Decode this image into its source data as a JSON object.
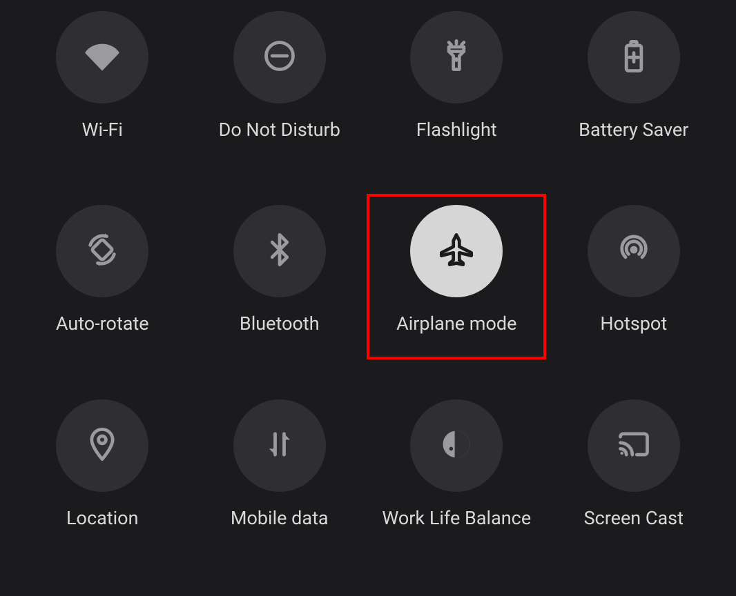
{
  "tiles": {
    "wifi": {
      "label": "Wi-Fi"
    },
    "dnd": {
      "label": "Do Not Disturb"
    },
    "flashlight": {
      "label": "Flashlight"
    },
    "battery_saver": {
      "label": "Battery Saver"
    },
    "auto_rotate": {
      "label": "Auto-rotate"
    },
    "bluetooth": {
      "label": "Bluetooth"
    },
    "airplane_mode": {
      "label": "Airplane mode",
      "active": true,
      "highlighted": true
    },
    "hotspot": {
      "label": "Hotspot"
    },
    "location": {
      "label": "Location"
    },
    "mobile_data": {
      "label": "Mobile data"
    },
    "work_life": {
      "label": "Work Life Balance"
    },
    "screen_cast": {
      "label": "Screen Cast"
    }
  }
}
